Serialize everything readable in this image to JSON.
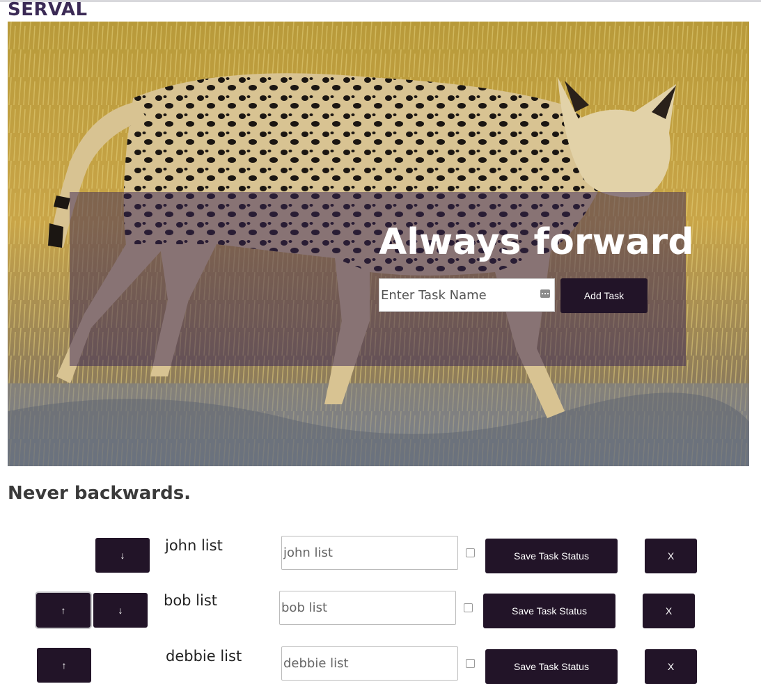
{
  "brand": {
    "title": "SERVAL"
  },
  "hero": {
    "image_description_icon": "serval-photo",
    "headline": "Always forward",
    "input_placeholder": "Enter Task Name",
    "add_button": "Add Task"
  },
  "subheading": "Never backwards.",
  "tasks": [
    {
      "label": "john list",
      "value": "john list",
      "checked": false,
      "save_button": "Save Task Status",
      "delete_button": "X",
      "up": null,
      "down": "↓"
    },
    {
      "label": "bob list",
      "value": "bob list",
      "checked": false,
      "save_button": "Save Task Status",
      "delete_button": "X",
      "up": "↑",
      "down": "↓"
    },
    {
      "label": "debbie list",
      "value": "debbie list",
      "checked": false,
      "save_button": "Save Task Status",
      "delete_button": "X",
      "up": "↑",
      "down": null
    }
  ],
  "colors": {
    "brand": "#3b2a55",
    "button": "#221428",
    "overlay": "#372355"
  }
}
